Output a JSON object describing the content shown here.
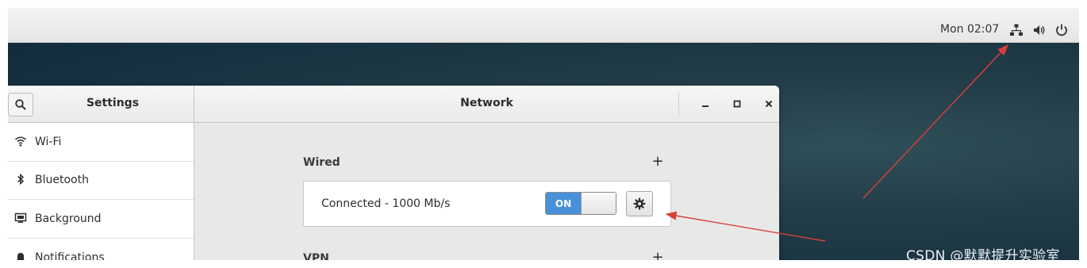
{
  "topbar": {
    "clock": "Mon 02:07",
    "icons": [
      "network-icon",
      "volume-icon",
      "power-icon"
    ]
  },
  "window": {
    "sidebar_title": "Settings",
    "title": "Network",
    "controls": [
      "minimize-icon",
      "maximize-icon",
      "close-icon"
    ]
  },
  "sidebar": {
    "items": [
      {
        "label": "Wi-Fi",
        "icon": "wifi-icon"
      },
      {
        "label": "Bluetooth",
        "icon": "bluetooth-icon"
      },
      {
        "label": "Background",
        "icon": "background-icon"
      },
      {
        "label": "Notifications",
        "icon": "bell-icon"
      }
    ]
  },
  "main": {
    "wired": {
      "title": "Wired",
      "add_label": "+",
      "status": "Connected - 1000 Mb/s",
      "toggle_label": "ON",
      "toggle_state": true,
      "settings_icon": "gear-icon"
    },
    "vpn": {
      "title": "VPN",
      "add_label": "+"
    }
  },
  "watermark": "CSDN @默默提升实验室",
  "colors": {
    "toggle_on": "#4a90d9",
    "annotation_arrow": "#d9403a"
  }
}
